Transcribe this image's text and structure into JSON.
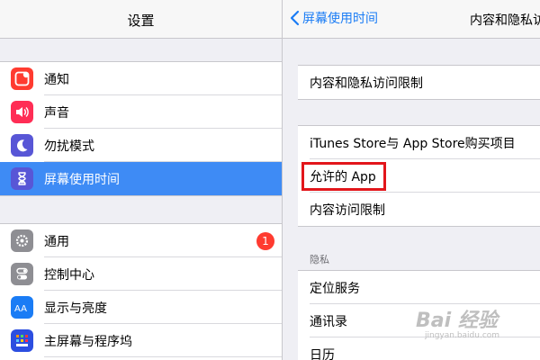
{
  "left_pane": {
    "title": "设置",
    "group1": [
      {
        "label": "通知",
        "icon": "notifications-icon",
        "color": "#ff3b30"
      },
      {
        "label": "声音",
        "icon": "sounds-icon",
        "color": "#ff2d55"
      },
      {
        "label": "勿扰模式",
        "icon": "do-not-disturb-icon",
        "color": "#5856d6"
      },
      {
        "label": "屏幕使用时间",
        "icon": "screen-time-icon",
        "color": "#5856d6",
        "selected": true
      }
    ],
    "group2": [
      {
        "label": "通用",
        "icon": "general-icon",
        "color": "#8e8e93",
        "badge": "1"
      },
      {
        "label": "控制中心",
        "icon": "control-center-icon",
        "color": "#8e8e93"
      },
      {
        "label": "显示与亮度",
        "icon": "display-icon",
        "color": "#1a7cf5"
      },
      {
        "label": "主屏幕与程序坞",
        "icon": "home-screen-icon",
        "color": "#2c4ee0"
      }
    ]
  },
  "right_pane": {
    "back_label": "屏幕使用时间",
    "title": "内容和隐私访",
    "group1": [
      {
        "label": "内容和隐私访问限制"
      }
    ],
    "group2": [
      {
        "label": "iTunes Store与 App Store购买项目"
      },
      {
        "label": "允许的 App"
      },
      {
        "label": "内容访问限制"
      }
    ],
    "section_privacy": "隐私",
    "group3": [
      {
        "label": "定位服务"
      },
      {
        "label": "通讯录"
      },
      {
        "label": "日历"
      }
    ]
  },
  "watermark": {
    "logo": "Bai 经验",
    "url": "jingyan.baidu.com"
  },
  "colors": {
    "accent": "#1a7cf5",
    "selected_row": "#3e8bf5",
    "highlight": "#e2161b",
    "badge": "#ff3b30"
  }
}
